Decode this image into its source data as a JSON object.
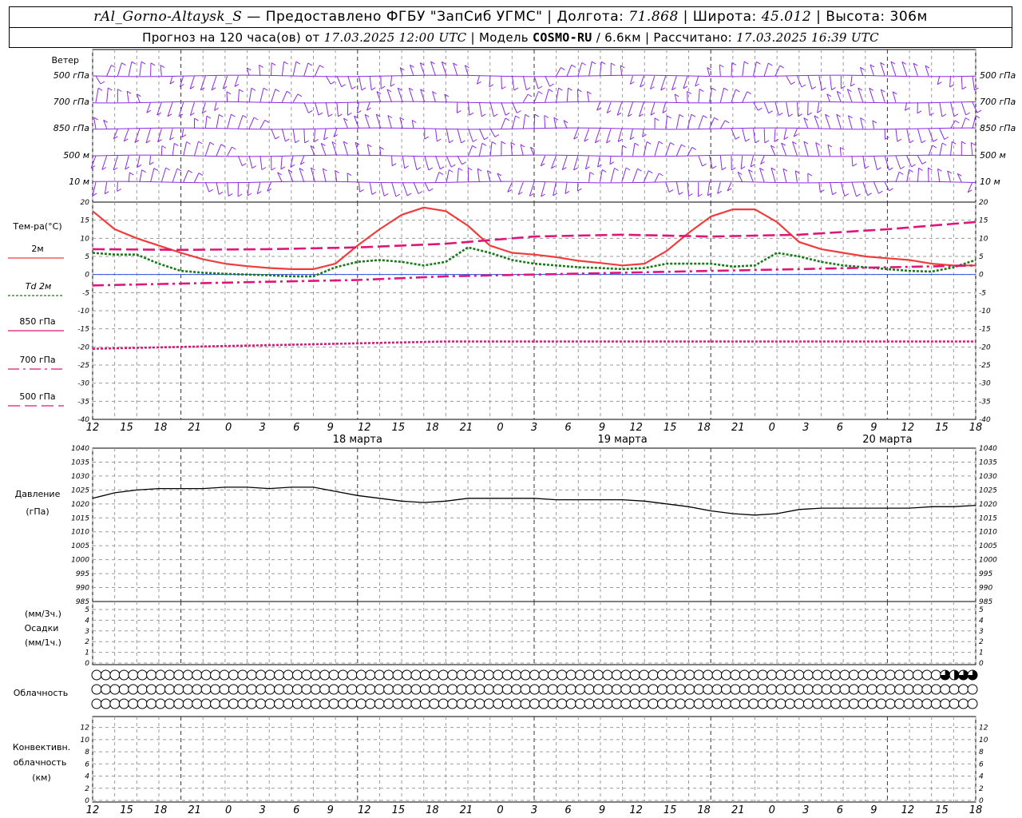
{
  "header": {
    "station": "rAl_Gorno-Altaysk_S",
    "provided_by": "— Предоставлено ФГБУ \"ЗапСиб УГМС\" |",
    "lon_label": "Долгота:",
    "lon_value": "71.868",
    "lat_label": "| Широта:",
    "lat_value": "45.012",
    "alt_label": "| Высота:",
    "alt_value": "306м",
    "forecast_label": "Прогноз на 120 часа(ов) от",
    "forecast_date": "17.03.2025 12:00 UTC",
    "model_label": "| Модель",
    "model_name": "COSMO-RU",
    "model_res": "/ 6.6км",
    "calc_label": "| Рассчитано:",
    "calc_date": "17.03.2025 16:39 UTC"
  },
  "colors": {
    "wind": "#8a2be2",
    "t2m": "#f03c3c",
    "td2m": "#1a7a1a",
    "t850": "#e0157a",
    "zero_line": "#3050e0",
    "pressure": "#000000",
    "grid": "#9a9a9a"
  },
  "panels": {
    "wind": {
      "title": "Ветер",
      "levels": [
        "500 гПа",
        "700 гПа",
        "850 гПа",
        "500 м",
        "10  м"
      ]
    },
    "temperature": {
      "title": "Тем-ра(°C)",
      "legend": [
        {
          "label": "2м",
          "style": "solid",
          "color": "#f03c3c"
        },
        {
          "label": "Td  2м",
          "style": "dotted",
          "color": "#1a7a1a"
        },
        {
          "label": "850 гПа",
          "style": "solid",
          "color": "#e0157a"
        },
        {
          "label": "700 гПа",
          "style": "dashdot",
          "color": "#e0157a"
        },
        {
          "label": "500 гПа",
          "style": "dashed",
          "color": "#e0157a"
        }
      ]
    },
    "pressure": {
      "title": "Давление",
      "unit": "(гПа)"
    },
    "precip": {
      "unit_top": "(мм/3ч.)",
      "title": "Осадки",
      "unit_bottom": "(мм/1ч.)"
    },
    "clouds": {
      "title": "Облачность"
    },
    "convective": {
      "title_line1": "Конвективн.",
      "title_line2": "облачность",
      "unit": "(км)"
    }
  },
  "chart_data": {
    "type": "line",
    "x_ticks": [
      "12",
      "15",
      "18",
      "21",
      "0",
      "3",
      "6",
      "9",
      "12",
      "15",
      "18",
      "21",
      "0",
      "3",
      "6",
      "9",
      "12",
      "15",
      "18",
      "21",
      "0",
      "3",
      "6",
      "9",
      "12",
      "15",
      "18"
    ],
    "day_labels": [
      "18 марта",
      "19 марта",
      "20 марта"
    ],
    "temperature": {
      "ylim": [
        -40,
        20
      ],
      "yticks": [
        20,
        15,
        10,
        5,
        0,
        -5,
        -10,
        -15,
        -20,
        -25,
        -30,
        -35,
        -40
      ],
      "series": [
        {
          "name": "2м",
          "x": [
            0,
            1,
            2,
            3,
            4,
            5,
            6,
            7,
            8,
            9,
            10,
            11,
            12,
            13,
            14,
            15,
            16,
            17,
            18,
            19,
            20,
            21,
            22,
            23,
            24,
            25,
            26,
            27,
            28,
            29,
            30,
            31,
            32,
            33,
            34,
            35,
            36,
            37,
            38,
            39,
            40
          ],
          "values": [
            17.5,
            12.5,
            10,
            8,
            6,
            4.2,
            3,
            2.3,
            1.8,
            1.5,
            1.5,
            3,
            8,
            12.5,
            16.5,
            18.5,
            17.5,
            13.5,
            8,
            6,
            5.5,
            4.8,
            3.8,
            3.2,
            2.5,
            3,
            6.5,
            11.5,
            16,
            18,
            18,
            14.5,
            9,
            7,
            6,
            5,
            4.5,
            4,
            3,
            2.5,
            2.5
          ]
        },
        {
          "name": "Td  2м",
          "x": [
            0,
            3,
            6,
            9,
            12,
            15,
            18,
            21,
            24,
            27,
            30,
            33,
            36,
            39,
            42,
            45,
            48,
            51,
            54,
            57,
            60,
            63,
            66,
            69,
            72,
            75,
            78,
            81,
            84,
            87,
            90,
            93,
            96,
            99,
            102,
            105,
            108,
            111,
            114,
            117,
            120
          ],
          "values": [
            6,
            5.5,
            5.5,
            3,
            1,
            0.5,
            0.2,
            0,
            -0.2,
            -0.5,
            -0.5,
            2,
            3.5,
            4,
            3.5,
            2.5,
            3.5,
            7.5,
            6,
            4,
            3,
            2.5,
            2,
            1.8,
            1.5,
            1.8,
            3,
            3,
            3,
            2.2,
            2.5,
            6,
            5,
            3.5,
            2.5,
            2,
            1.5,
            1,
            0.8,
            2,
            4
          ]
        },
        {
          "name": "850 гПа",
          "x": [
            0,
            12,
            24,
            36,
            48,
            60,
            72,
            84,
            96,
            108,
            120
          ],
          "values": [
            7,
            6.8,
            7,
            7.5,
            8.5,
            10.5,
            11,
            10.5,
            11,
            12.5,
            14.5
          ]
        },
        {
          "name": "700 гПа",
          "x": [
            0,
            12,
            24,
            36,
            48,
            60,
            72,
            84,
            96,
            108,
            120
          ],
          "values": [
            -3,
            -2.5,
            -2,
            -1.5,
            -0.5,
            0,
            0.5,
            1,
            1.5,
            2,
            2.5
          ]
        },
        {
          "name": "500 гПа",
          "x": [
            0,
            12,
            24,
            36,
            48,
            60,
            72,
            84,
            96,
            108,
            120
          ],
          "values": [
            -20.5,
            -20,
            -19.5,
            -19,
            -18.5,
            -18.5,
            -18.5,
            -18.5,
            -18.5,
            -18.5,
            -18.5
          ]
        }
      ]
    },
    "pressure": {
      "ylim": [
        985,
        1040
      ],
      "yticks": [
        1040,
        1035,
        1030,
        1025,
        1020,
        1015,
        1010,
        1005,
        1000,
        995,
        990,
        985
      ],
      "x": [
        0,
        3,
        6,
        9,
        12,
        15,
        18,
        21,
        24,
        27,
        30,
        33,
        36,
        39,
        42,
        45,
        48,
        51,
        54,
        57,
        60,
        63,
        66,
        69,
        72,
        75,
        78,
        81,
        84,
        87,
        90,
        93,
        96,
        99,
        102,
        105,
        108,
        111,
        114,
        117,
        120
      ],
      "values": [
        1022,
        1024,
        1025,
        1025.5,
        1025.5,
        1025.5,
        1026,
        1026,
        1025.5,
        1026,
        1026,
        1024.5,
        1023,
        1022,
        1021,
        1020.5,
        1021,
        1022,
        1022,
        1022,
        1022,
        1021.5,
        1021.5,
        1021.5,
        1021.5,
        1021,
        1020,
        1019,
        1017.5,
        1016.5,
        1016,
        1016.5,
        1018,
        1018.5,
        1018.5,
        1018.5,
        1018.5,
        1018.5,
        1019,
        1019,
        1019.5
      ]
    },
    "precip": {
      "ylim": [
        0,
        5
      ],
      "yticks": [
        5,
        4,
        3,
        2,
        1,
        0
      ],
      "values": []
    },
    "clouds": {
      "rows": 3,
      "columns": 97,
      "low_cover": [
        0,
        0,
        0,
        0,
        0,
        0,
        0,
        0,
        0,
        0,
        0,
        0,
        0,
        0,
        0,
        0,
        0,
        0,
        0,
        0,
        0,
        0,
        0,
        0,
        0,
        0,
        0,
        0,
        0,
        0,
        0,
        0,
        0,
        0,
        0,
        0,
        0,
        0,
        0,
        0,
        0,
        0,
        0,
        0,
        0,
        0,
        0,
        0,
        0,
        0,
        0,
        0,
        0,
        0,
        0,
        0,
        0,
        0,
        0,
        0,
        0,
        0,
        0,
        0,
        0,
        0,
        0,
        0,
        0,
        0,
        0,
        0,
        0,
        0,
        0,
        0,
        0,
        0,
        0,
        0,
        0,
        0,
        0,
        0,
        0,
        0,
        0,
        0,
        0,
        0,
        0,
        0,
        0,
        0.75,
        0.5,
        0.75,
        0.75
      ],
      "mid_cover": 0,
      "high_cover": 0
    },
    "convective": {
      "ylim": [
        0,
        13
      ],
      "yticks": [
        12,
        10,
        8,
        6,
        4,
        2,
        0
      ],
      "values": []
    }
  }
}
